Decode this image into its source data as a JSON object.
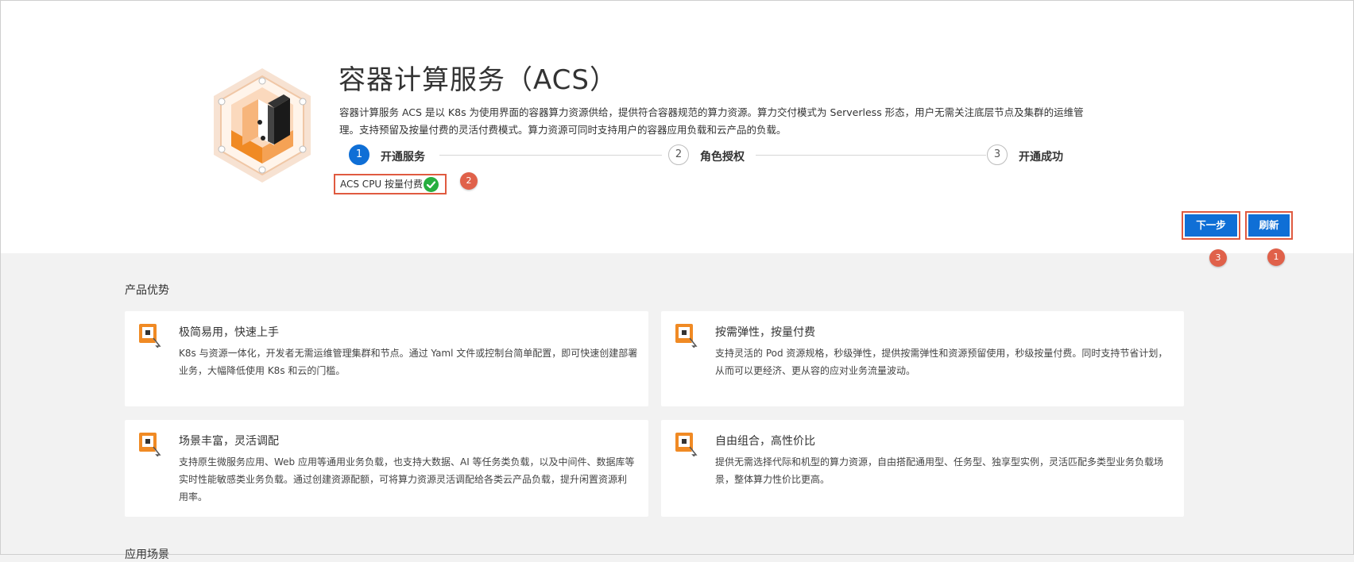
{
  "service": {
    "title": "容器计算服务（ACS）",
    "description": "容器计算服务 ACS 是以 K8s 为使用界面的容器算力资源供给，提供符合容器规范的算力资源。算力交付模式为 Serverless 形态，用户无需关注底层节点及集群的运维管理。支持预留及按量付费的灵活付费模式。算力资源可同时支持用户的容器应用负载和云产品的负载。"
  },
  "steps": [
    {
      "number": "1",
      "label": "开通服务",
      "state": "active"
    },
    {
      "number": "2",
      "label": "角色授权",
      "state": "inactive"
    },
    {
      "number": "3",
      "label": "开通成功",
      "state": "inactive"
    }
  ],
  "billing": {
    "label": "ACS CPU 按量付费",
    "status_icon": "check-circle-icon",
    "status_color": "#27ae3f"
  },
  "actions": {
    "next_label": "下一步",
    "refresh_label": "刷新"
  },
  "annotations": {
    "refresh_badge": "1",
    "billing_badge": "2",
    "next_badge": "3",
    "badge_color": "#e0614a"
  },
  "colors": {
    "primary": "#0f6fd6",
    "highlight_border": "#e05a40",
    "logo_orange": "#f08a24"
  },
  "advantages": {
    "heading": "产品优势",
    "items": [
      {
        "title": "极简易用，快速上手",
        "lines": [
          "K8s 与资源一体化，开发者无需运维管理集群和节点。通过 Yaml 文件或控制台简单配置，即可快速创建部署",
          "业务，大幅降低使用 K8s 和云的门槛。"
        ]
      },
      {
        "title": "按需弹性，按量付费",
        "lines": [
          "支持灵活的 Pod 资源规格，秒级弹性，提供按需弹性和资源预留使用，秒级按量付费。同时支持节省计划，",
          "从而可以更经济、更从容的应对业务流量波动。"
        ]
      },
      {
        "title": "场景丰富，灵活调配",
        "lines": [
          "支持原生微服务应用、Web 应用等通用业务负载，也支持大数据、AI 等任务类负载，以及中间件、数据库等",
          "实时性能敏感类业务负载。通过创建资源配额，可将算力资源灵活调配给各类云产品负载，提升闲置资源利",
          "用率。"
        ]
      },
      {
        "title": "自由组合，高性价比",
        "lines": [
          "提供无需选择代际和机型的算力资源，自由搭配通用型、任务型、独享型实例，灵活匹配多类型业务负载场",
          "景，整体算力性价比更高。"
        ]
      }
    ]
  },
  "scenarios": {
    "heading": "应用场景"
  }
}
